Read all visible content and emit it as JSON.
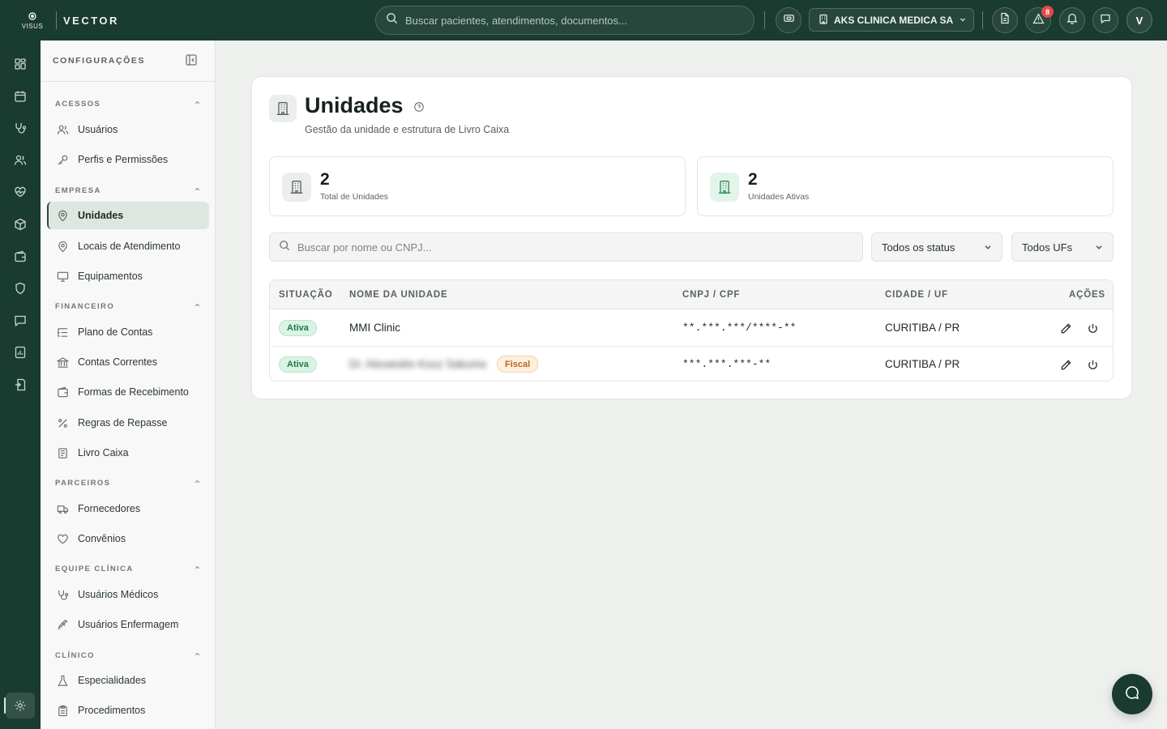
{
  "app": {
    "logo_text": "VISUS",
    "name": "VECTOR"
  },
  "topbar": {
    "search_placeholder": "Buscar pacientes, atendimentos, documentos...",
    "company": "AKS CLINICA MEDICA SA",
    "alert_count": "8",
    "avatar_initial": "V"
  },
  "rail": {
    "icons": [
      "dashboard-icon",
      "calendar-icon",
      "stethoscope-icon",
      "users-icon",
      "heart-pulse-icon",
      "package-icon",
      "wallet-icon",
      "shield-icon",
      "message-icon",
      "report-icon",
      "transfer-icon",
      "settings-icon"
    ],
    "active": "settings-icon"
  },
  "sidebar": {
    "title": "CONFIGURAÇÕES",
    "sections": {
      "acessos": "ACESSOS",
      "empresa": "EMPRESA",
      "financeiro": "FINANCEIRO",
      "parceiros": "PARCEIROS",
      "equipe": "EQUIPE CLÍNICA",
      "clinico": "CLÍNICO"
    },
    "items": {
      "usuarios": "Usuários",
      "perfis": "Perfis e Permissões",
      "unidades": "Unidades",
      "locais": "Locais de Atendimento",
      "equipamentos": "Equipamentos",
      "plano": "Plano de Contas",
      "contas": "Contas Correntes",
      "formas": "Formas de Recebimento",
      "regras": "Regras de Repasse",
      "livro": "Livro Caixa",
      "fornecedores": "Fornecedores",
      "convenios": "Convênios",
      "medicos": "Usuários Médicos",
      "enfermagem": "Usuários Enfermagem",
      "especialidades": "Especialidades",
      "procedimentos": "Procedimentos"
    }
  },
  "page": {
    "title": "Unidades",
    "subtitle": "Gestão da unidade e estrutura de Livro Caixa"
  },
  "stats": {
    "total": {
      "value": "2",
      "label": "Total de Unidades"
    },
    "active": {
      "value": "2",
      "label": "Unidades Ativas"
    }
  },
  "filters": {
    "search_placeholder": "Buscar por nome ou CNPJ...",
    "status": "Todos os status",
    "uf": "Todos UFs"
  },
  "table": {
    "headers": {
      "status": "SITUAÇÃO",
      "name": "NOME DA UNIDADE",
      "doc": "CNPJ / CPF",
      "city": "CIDADE / UF",
      "actions": "AÇÕES"
    },
    "rows": [
      {
        "status": "Ativa",
        "name": "MMI Clinic",
        "tag": "",
        "doc": "**.***.***/****-**",
        "city": "CURITIBA / PR"
      },
      {
        "status": "Ativa",
        "name": "Dr. Alexandre Kouz Sakuma",
        "tag": "Fiscal",
        "doc": "***.***.***-**",
        "city": "CURITIBA / PR"
      }
    ]
  },
  "colors": {
    "brand_dark": "#1a3b30",
    "active_badge": "#1f7a4a",
    "fiscal_badge": "#c0621d",
    "alert_badge": "#e5484d"
  }
}
